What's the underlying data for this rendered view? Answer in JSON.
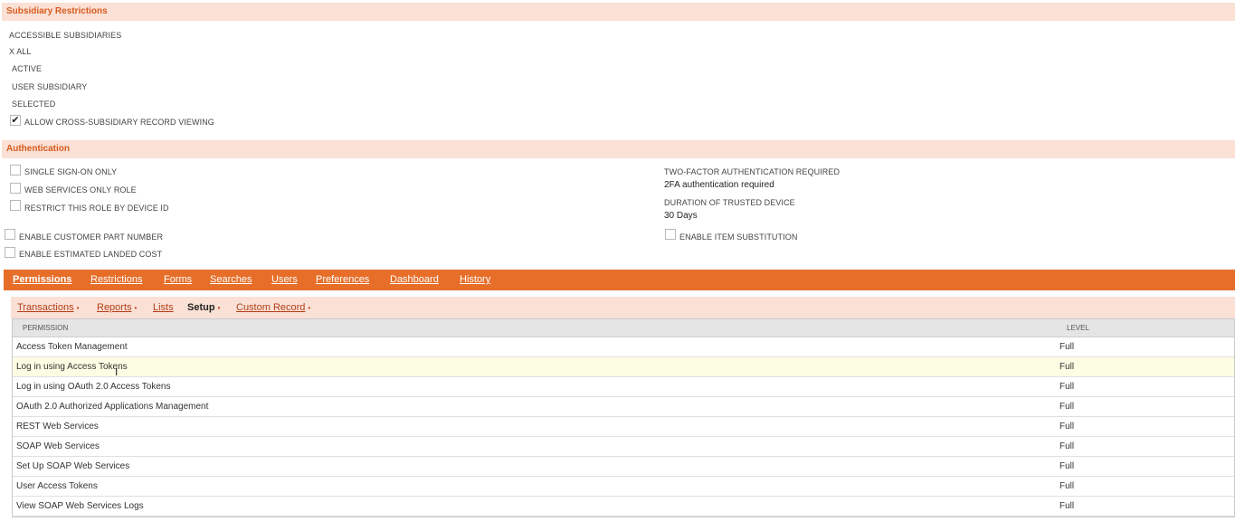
{
  "subsidiary": {
    "header": "Subsidiary Restrictions",
    "accessible_label": "ACCESSIBLE SUBSIDIARIES",
    "options": [
      "X ALL",
      "ACTIVE",
      "USER SUBSIDIARY",
      "SELECTED"
    ],
    "cross_viewing_label": "ALLOW CROSS-SUBSIDIARY RECORD VIEWING",
    "cross_viewing_checked": true
  },
  "authentication": {
    "header": "Authentication",
    "sso_label": "SINGLE SIGN-ON ONLY",
    "ws_only_label": "WEB SERVICES ONLY ROLE",
    "restrict_device_label": "RESTRICT THIS ROLE BY DEVICE ID",
    "customer_part_label": "ENABLE CUSTOMER PART NUMBER",
    "landed_cost_label": "ENABLE ESTIMATED LANDED COST",
    "two_factor_label": "TWO-FACTOR AUTHENTICATION REQUIRED",
    "two_factor_value": "2FA authentication required",
    "trusted_device_label": "DURATION OF TRUSTED DEVICE",
    "trusted_device_value": "30 Days",
    "item_substitution_label": "ENABLE ITEM SUBSTITUTION"
  },
  "tabs": [
    {
      "label": "Permissions",
      "active": true
    },
    {
      "label": "Restrictions"
    },
    {
      "label": "Forms"
    },
    {
      "label": "Searches"
    },
    {
      "label": "Users"
    },
    {
      "label": "Preferences"
    },
    {
      "label": "Dashboard"
    },
    {
      "label": "History"
    }
  ],
  "subtabs": [
    {
      "label": "Transactions",
      "dot": "•"
    },
    {
      "label": "Reports",
      "dot": "•"
    },
    {
      "label": "Lists",
      "dot": ""
    },
    {
      "label": "Setup",
      "dot": "•",
      "active": true
    },
    {
      "label": "Custom Record",
      "dot": "•"
    }
  ],
  "table": {
    "col_permission": "PERMISSION",
    "col_level": "LEVEL",
    "rows": [
      {
        "permission": "Access Token Management",
        "level": "Full"
      },
      {
        "permission": "Log in using Access Tokens",
        "level": "Full"
      },
      {
        "permission": "Log in using OAuth 2.0 Access Tokens",
        "level": "Full"
      },
      {
        "permission": "OAuth 2.0 Authorized Applications Management",
        "level": "Full"
      },
      {
        "permission": "REST Web Services",
        "level": "Full"
      },
      {
        "permission": "SOAP Web Services",
        "level": "Full"
      },
      {
        "permission": "Set Up SOAP Web Services",
        "level": "Full"
      },
      {
        "permission": "User Access Tokens",
        "level": "Full"
      },
      {
        "permission": "View SOAP Web Services Logs",
        "level": "Full"
      }
    ]
  },
  "icons": {
    "checkmark": "✔",
    "bullet": "•",
    "text_cursor": "I"
  },
  "colors": {
    "accent": "#e66e29",
    "section_bg": "#fbe0d5",
    "section_text": "#d65b1e",
    "row_highlight": "#fdfde3"
  }
}
